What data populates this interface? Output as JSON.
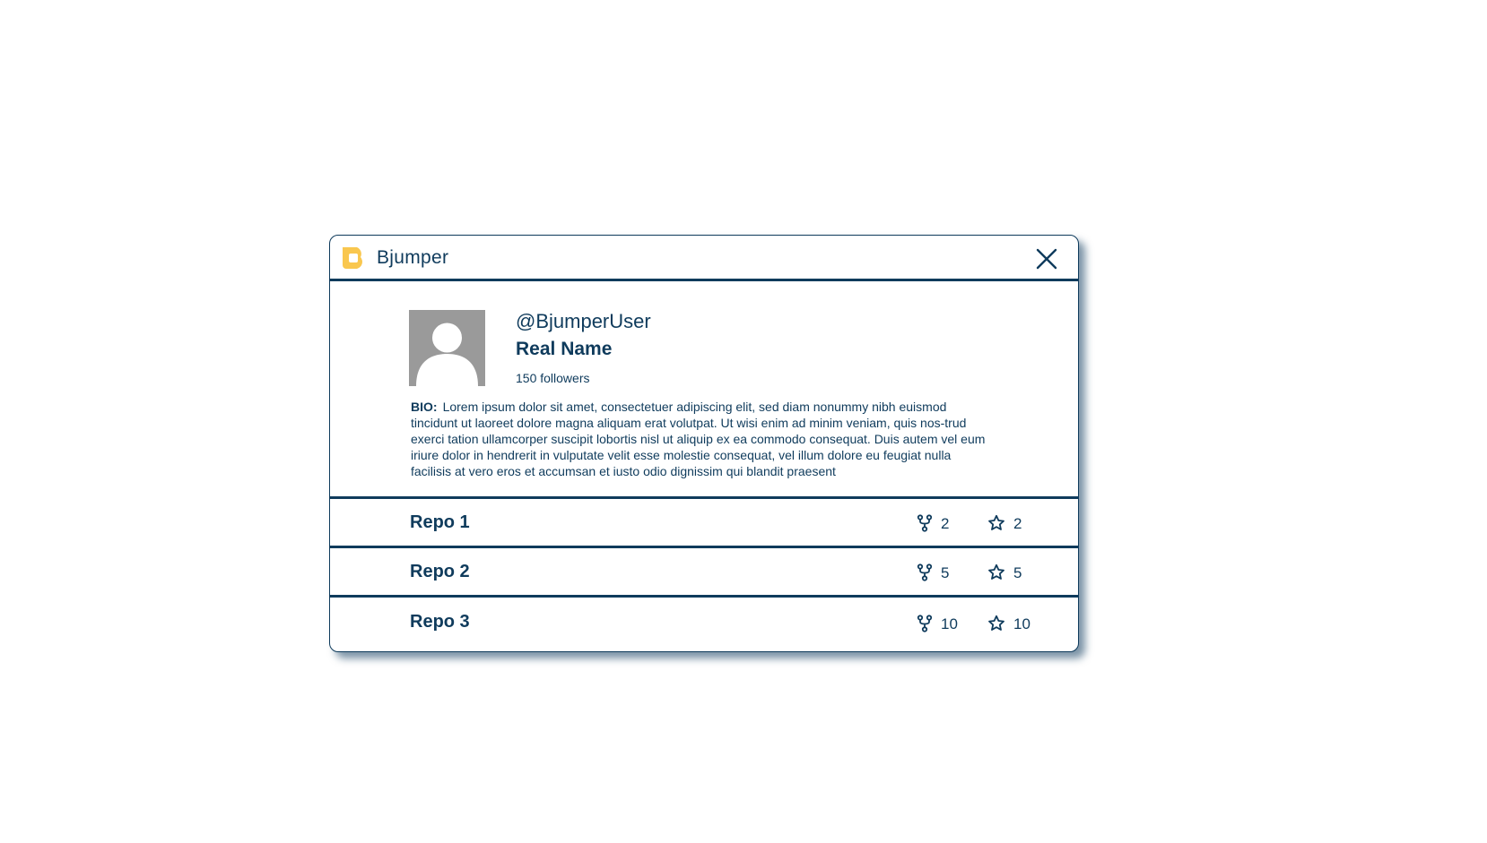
{
  "window": {
    "brand_name": "Bjumper",
    "logo_icon": "bjumper-logo-icon",
    "close_icon": "close-icon",
    "accent_color": "#0f3b5c",
    "logo_color": "#f9c74f"
  },
  "profile": {
    "avatar_icon": "default-avatar-icon",
    "handle": "@BjumperUser",
    "real_name": "Real Name",
    "followers": "150 followers",
    "bio_label": "BIO:",
    "bio_text": "Lorem ipsum dolor sit amet, consectetuer adipiscing elit, sed diam nonummy nibh euismod tincidunt ut laoreet dolore magna aliquam erat volutpat. Ut wisi enim ad minim veniam, quis nos-trud exerci tation ullamcorper suscipit lobortis nisl ut aliquip ex ea commodo consequat. Duis autem vel eum iriure dolor in hendrerit in vulputate velit esse molestie consequat, vel illum dolore eu feugiat nulla facilisis at vero eros et accumsan et iusto odio dignissim qui blandit praesent"
  },
  "repos": [
    {
      "name": "Repo 1",
      "forks": "2",
      "stars": "2"
    },
    {
      "name": "Repo 2",
      "forks": "5",
      "stars": "5"
    },
    {
      "name": "Repo 3",
      "forks": "10",
      "stars": "10"
    }
  ]
}
